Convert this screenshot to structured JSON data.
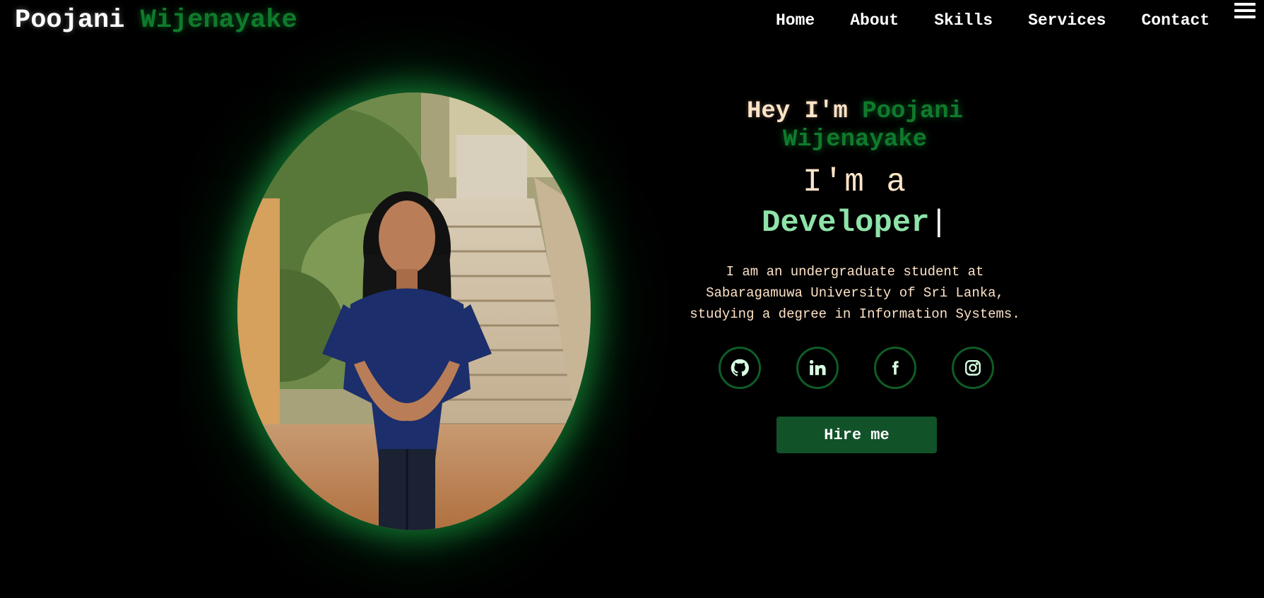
{
  "header": {
    "logo_first": "Poojani",
    "logo_last": "Wijenayake",
    "nav": [
      {
        "label": "Home"
      },
      {
        "label": "About"
      },
      {
        "label": "Skills"
      },
      {
        "label": "Services"
      },
      {
        "label": "Contact"
      }
    ],
    "menu_icon": "hamburger-icon"
  },
  "hero": {
    "greeting_prefix": "Hey I'm",
    "greeting_name": "Poojani Wijenayake",
    "iam": "I'm a",
    "role": "Developer",
    "cursor": "|",
    "bio": "I am an undergraduate student at Sabaragamuwa University of Sri Lanka, studying a degree in Information Systems.",
    "socials": [
      {
        "icon": "github-icon"
      },
      {
        "icon": "linkedin-icon"
      },
      {
        "icon": "facebook-icon"
      },
      {
        "icon": "instagram-icon"
      }
    ],
    "hire_label": "Hire me"
  },
  "colors": {
    "background": "#000000",
    "accent_green": "#0f7a2c",
    "role_green": "#8ee3a8",
    "cream": "#ffe4c8",
    "button": "#115229"
  }
}
